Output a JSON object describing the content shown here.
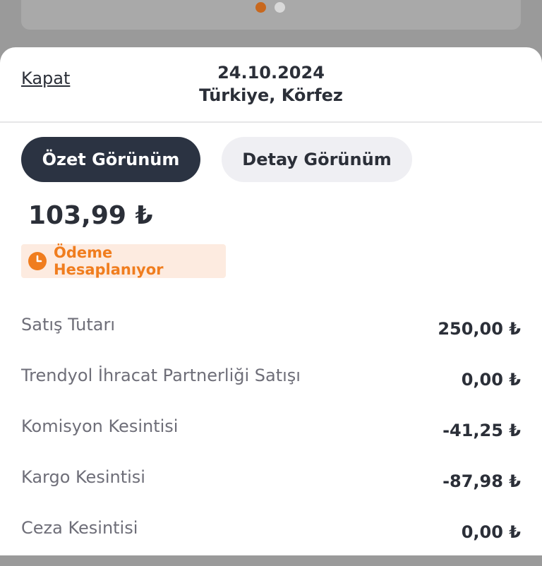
{
  "carousel": {
    "dots": [
      {
        "color": "#c8681e",
        "active": true
      },
      {
        "color": "#d9d9d9",
        "active": false
      }
    ]
  },
  "header": {
    "close_label": "Kapat",
    "date": "24.10.2024",
    "location": "Türkiye, Körfez"
  },
  "view_toggle": {
    "summary_label": "Özet Görünüm",
    "detail_label": "Detay Görünüm",
    "selected": "summary"
  },
  "amount": "103,99 ₺",
  "status": {
    "label": "Ödeme Hesaplanıyor",
    "icon": "clock-icon",
    "color": "#f07d1e",
    "background": "#fdebe0"
  },
  "rows": [
    {
      "label": "Satış Tutarı",
      "value": "250,00 ₺"
    },
    {
      "label": "Trendyol İhracat Partnerliği Satışı",
      "value": "0,00 ₺"
    },
    {
      "label": "Komisyon Kesintisi",
      "value": "-41,25 ₺"
    },
    {
      "label": "Kargo Kesintisi",
      "value": "-87,98 ₺"
    },
    {
      "label": "Ceza Kesintisi",
      "value": "0,00 ₺"
    }
  ]
}
